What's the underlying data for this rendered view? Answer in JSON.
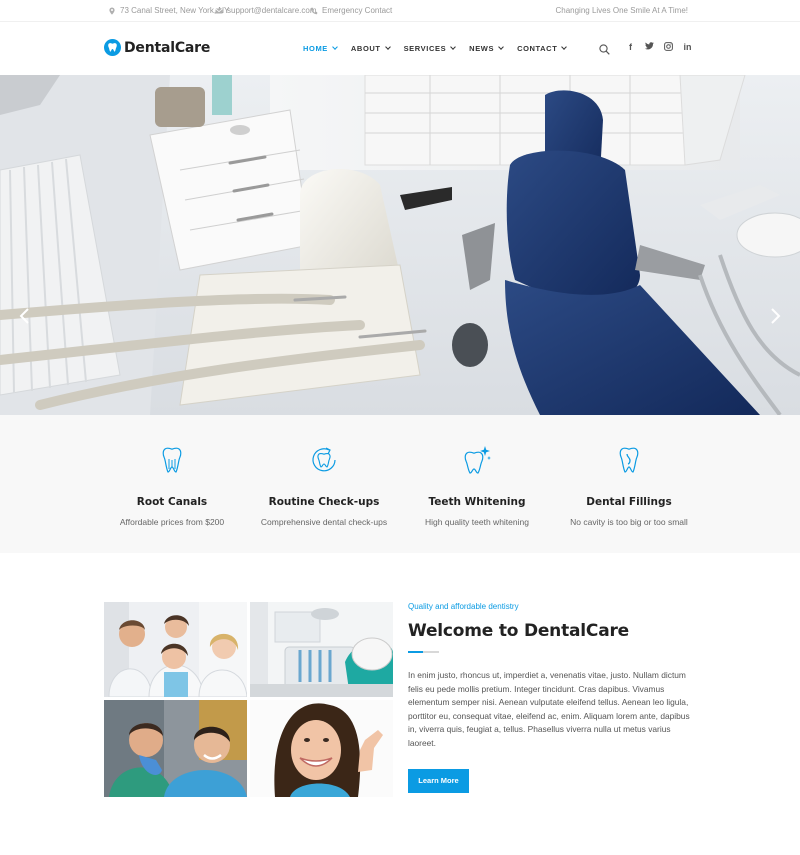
{
  "topbar": {
    "address": "73 Canal Street, New York, NY",
    "email": "support@dentalcare.com",
    "phone": "Emergency Contact",
    "tagline": "Changing Lives One Smile At A Time!"
  },
  "brand": {
    "name": "DentalCare",
    "accent": "#0b9be3"
  },
  "nav": [
    {
      "label": "HOME",
      "active": true
    },
    {
      "label": "ABOUT"
    },
    {
      "label": "SERVICES"
    },
    {
      "label": "NEWS"
    },
    {
      "label": "CONTACT"
    }
  ],
  "social": [
    "facebook-icon",
    "twitter-icon",
    "instagram-icon",
    "linkedin-icon"
  ],
  "services": [
    {
      "title": "Root Canals",
      "desc": "Affordable prices from $200",
      "icon": "tooth-roots-icon"
    },
    {
      "title": "Routine Check-ups",
      "desc": "Comprehensive dental check-ups",
      "icon": "tooth-checkup-icon"
    },
    {
      "title": "Teeth Whitening",
      "desc": "High quality teeth whitening",
      "icon": "tooth-sparkle-icon"
    },
    {
      "title": "Dental Fillings",
      "desc": "No cavity is too big or too small",
      "icon": "tooth-filling-icon"
    }
  ],
  "about": {
    "kicker": "Quality and affordable dentistry",
    "heading": "Welcome to DentalCare",
    "body": "In enim justo, rhoncus ut, imperdiet a, venenatis vitae, justo. Nullam dictum felis eu pede mollis pretium. Integer tincidunt. Cras dapibus. Vivamus elementum semper nisi. Aenean vulputate eleifend tellus. Aenean leo ligula, porttitor eu, consequat vitae, eleifend ac, enim. Aliquam lorem ante, dapibus in, viverra quis, feugiat a, tellus. Phasellus viverra nulla ut metus varius laoreet.",
    "button": "Learn More"
  }
}
